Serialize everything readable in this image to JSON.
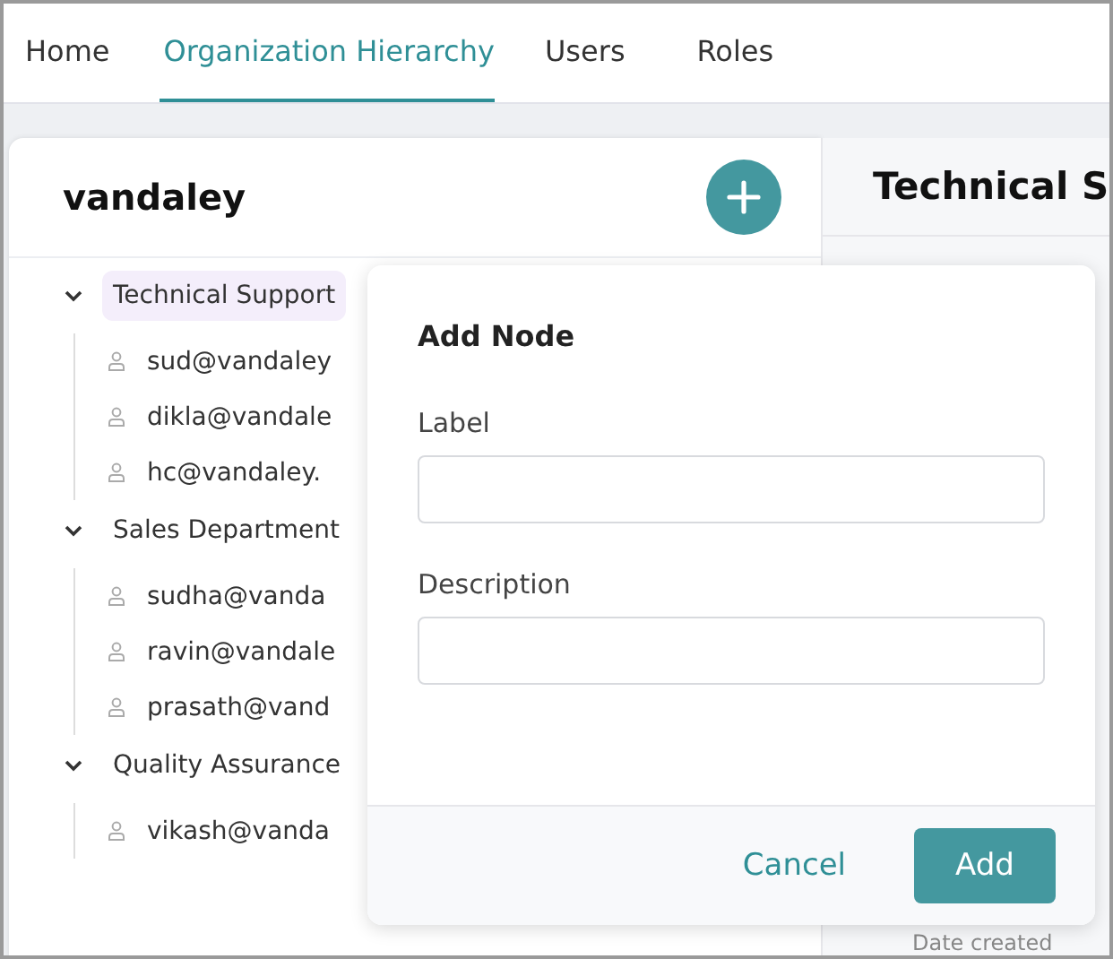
{
  "tabs": [
    {
      "label": "Home",
      "selected": false
    },
    {
      "label": "Organization Hierarchy",
      "selected": true
    },
    {
      "label": "Users",
      "selected": false
    },
    {
      "label": "Roles",
      "selected": false
    }
  ],
  "tree": {
    "title": "vandaley",
    "groups": [
      {
        "label": "Technical Support",
        "expanded": true,
        "selected": true,
        "children": [
          {
            "label": "sud@vandaley"
          },
          {
            "label": "dikla@vandale"
          },
          {
            "label": "hc@vandaley."
          }
        ]
      },
      {
        "label": "Sales Department",
        "expanded": true,
        "selected": false,
        "children": [
          {
            "label": "sudha@vanda"
          },
          {
            "label": "ravin@vandale"
          },
          {
            "label": "prasath@vand"
          }
        ]
      },
      {
        "label": "Quality Assurance",
        "expanded": true,
        "selected": false,
        "children": [
          {
            "label": "vikash@vanda"
          }
        ]
      }
    ]
  },
  "detail": {
    "title": "Technical S",
    "field_label": "Date created"
  },
  "dialog": {
    "title": "Add Node",
    "fields": [
      {
        "label": "Label"
      },
      {
        "label": "Description"
      }
    ],
    "buttons": [
      {
        "label": "Cancel",
        "kind": "text"
      },
      {
        "label": "Add",
        "kind": "primary"
      }
    ]
  }
}
